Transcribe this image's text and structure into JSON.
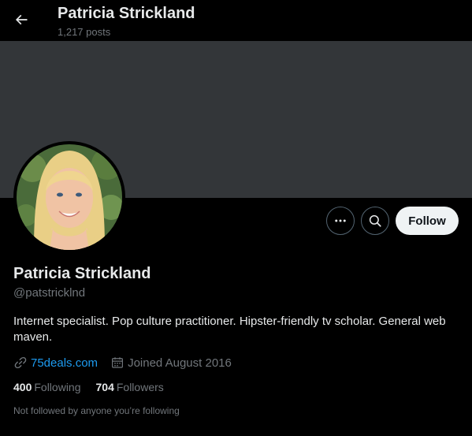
{
  "header": {
    "name": "Patricia Strickland",
    "posts": "1,217 posts"
  },
  "profile": {
    "display_name": "Patricia Strickland",
    "handle": "@patstricklnd",
    "bio": "Internet specialist. Pop culture practitioner. Hipster-friendly tv scholar. General web maven.",
    "website": "75deals.com",
    "joined": "Joined August 2016"
  },
  "actions": {
    "follow_label": "Follow",
    "more_icon": "more-icon",
    "search_icon": "search-icon"
  },
  "stats": {
    "following_count": "400",
    "following_label": "Following",
    "followers_count": "704",
    "followers_label": "Followers"
  },
  "social_context": "Not followed by anyone you’re following",
  "colors": {
    "background": "#000000",
    "banner": "#333639",
    "primary_text": "#e7e9ea",
    "secondary_text": "#71767b",
    "link": "#1d9bf0",
    "follow_button": "#eff3f4"
  }
}
